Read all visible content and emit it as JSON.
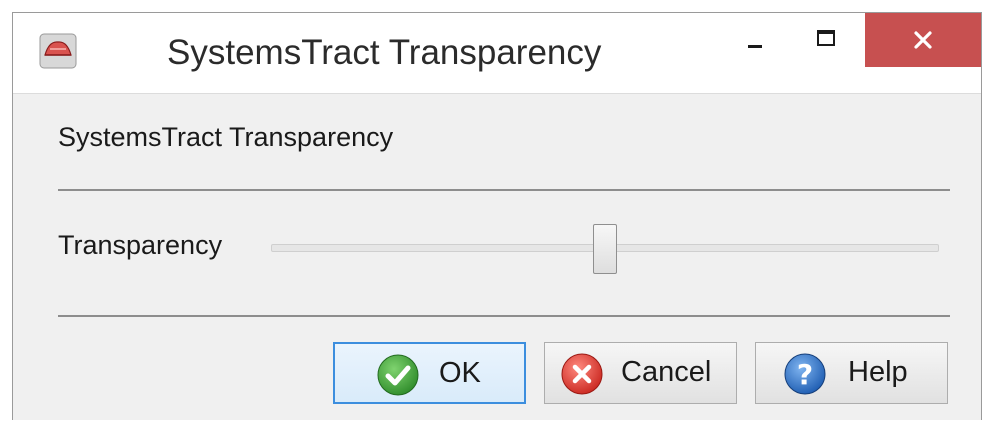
{
  "window": {
    "title": "SystemsTract Transparency",
    "app_icon": "red-cross-section-icon",
    "controls": {
      "minimize": "minimize-icon",
      "maximize": "maximize-icon",
      "close": "close-icon"
    }
  },
  "dialog": {
    "header": "SystemsTract Transparency",
    "slider": {
      "label": "Transparency",
      "value": 0.5,
      "min": 0,
      "max": 1
    }
  },
  "buttons": {
    "ok": {
      "label": "OK",
      "icon": "check-icon"
    },
    "cancel": {
      "label": "Cancel",
      "icon": "cancel-x-icon"
    },
    "help": {
      "label": "Help",
      "icon": "question-mark-icon"
    }
  },
  "colors": {
    "close_button": "#c75050",
    "ok_border": "#3c8ede",
    "ok_icon": "#3ea33a",
    "cancel_icon": "#e0403a",
    "help_icon": "#2a6fc9"
  }
}
